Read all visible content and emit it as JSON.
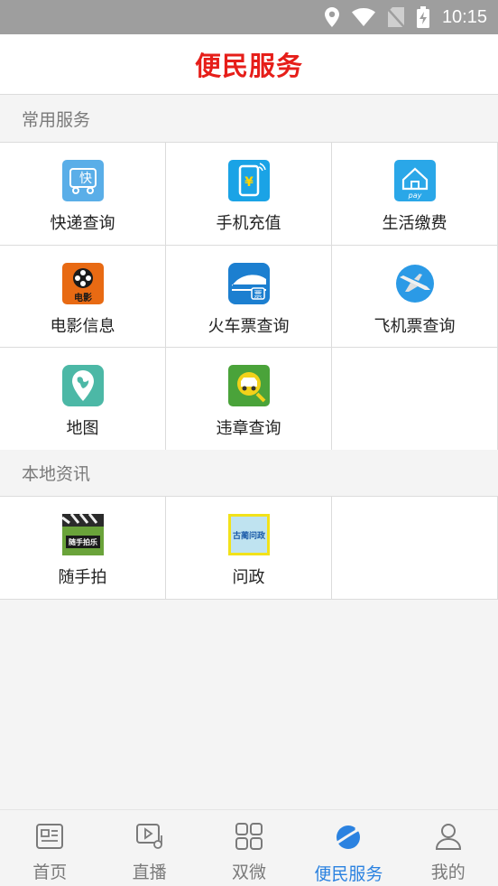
{
  "status_bar": {
    "time": "10:15",
    "icons": [
      "location-icon",
      "wifi-icon",
      "no-sim-icon",
      "battery-charging-icon"
    ]
  },
  "header": {
    "title": "便民服务"
  },
  "sections": [
    {
      "title": "常用服务",
      "items": [
        {
          "label": "快递查询",
          "icon": "express-icon",
          "color": "#5aaee8"
        },
        {
          "label": "手机充值",
          "icon": "phone-recharge-icon",
          "color": "#1aa3e6"
        },
        {
          "label": "生活缴费",
          "icon": "life-pay-icon",
          "color": "#2aa7e8"
        },
        {
          "label": "电影信息",
          "icon": "movie-icon",
          "color": "#e86a13"
        },
        {
          "label": "火车票查询",
          "icon": "train-ticket-icon",
          "color": "#1c7fd0"
        },
        {
          "label": "飞机票查询",
          "icon": "plane-ticket-icon",
          "color": "#2b9ae6"
        },
        {
          "label": "地图",
          "icon": "map-icon",
          "color": "#4cb8a6"
        },
        {
          "label": "违章查询",
          "icon": "violation-query-icon",
          "color": "#4aa33a"
        }
      ]
    },
    {
      "title": "本地资讯",
      "items": [
        {
          "label": "随手拍",
          "icon": "snapshot-icon",
          "icon_text": "随手拍乐"
        },
        {
          "label": "问政",
          "icon": "inquiry-icon",
          "icon_text": "古蔺问政"
        }
      ]
    }
  ],
  "express_icon_text": "快",
  "movie_icon_text": "电影",
  "train_icon_text": "票",
  "pay_icon_text": "pay",
  "tabs": [
    {
      "label": "首页",
      "icon": "news-icon",
      "active": false
    },
    {
      "label": "直播",
      "icon": "live-play-icon",
      "active": false
    },
    {
      "label": "双微",
      "icon": "grid-icon",
      "active": false
    },
    {
      "label": "便民服务",
      "icon": "service-planet-icon",
      "active": true
    },
    {
      "label": "我的",
      "icon": "user-icon",
      "active": false
    }
  ],
  "colors": {
    "brand_red": "#e61e19",
    "active_blue": "#2b82e0",
    "muted_gray": "#7a7a7a"
  }
}
